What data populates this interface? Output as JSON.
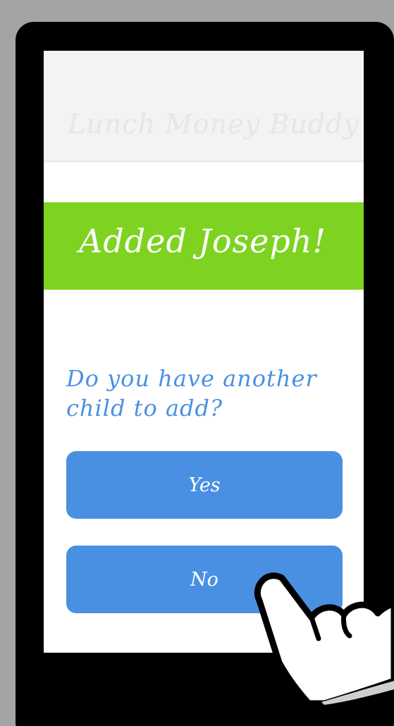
{
  "app": {
    "title": "Lunch Money Buddy"
  },
  "banner": {
    "message": "Added Joseph!"
  },
  "prompt": {
    "question": "Do you have another child to add?"
  },
  "actions": {
    "yes_label": "Yes",
    "no_label": "No"
  },
  "icons": {
    "pointer": "pointing-hand-icon"
  },
  "colors": {
    "banner": "#7ed321",
    "accent": "#4a90e2",
    "header_bg": "#f3f3f3"
  }
}
